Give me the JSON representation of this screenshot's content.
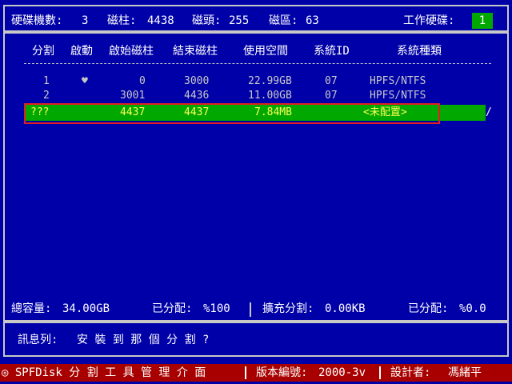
{
  "header": {
    "disk_count_label": "硬碟機數:",
    "disk_count": "3",
    "cylinders_label": "磁柱:",
    "cylinders": "4438",
    "heads_label": "磁頭:",
    "heads": "255",
    "sectors_label": "磁區:",
    "sectors": "63",
    "work_disk_label": "工作硬碟:",
    "work_disk": "1"
  },
  "columns": {
    "partition": "分割",
    "boot": "啟動",
    "start_cyl": "啟始磁柱",
    "end_cyl": "結束磁柱",
    "used_space": "使用空間",
    "system_id": "系統ID",
    "system_type": "系統種類"
  },
  "rows": [
    {
      "partition": "1",
      "boot": "♥",
      "start": "0",
      "end": "3000",
      "size": "22.99GB",
      "id": "07",
      "type": "HPFS/NTFS"
    },
    {
      "partition": "2",
      "boot": "",
      "start": "3001",
      "end": "4436",
      "size": "11.00GB",
      "id": "07",
      "type": "HPFS/NTFS"
    },
    {
      "partition": "???",
      "boot": "",
      "start": "4437",
      "end": "4437",
      "size": "7.84MB",
      "id": "",
      "type": "<未配置>"
    }
  ],
  "summary": {
    "total_label": "總容量:",
    "total": "34.00GB",
    "allocated_label": "已分配:",
    "allocated_pct": "%100",
    "extended_label": "擴充分割:",
    "extended": "0.00KB",
    "ext_allocated_label": "已分配:",
    "ext_allocated_pct": "%0.0"
  },
  "message": {
    "label": "訊息列:",
    "text": "安 裝 到 那 個 分 割 ?"
  },
  "footer": {
    "app_name": "◎ SPFDisk 分 割 工 具 管 理 介 面",
    "version_label": "版本編號:",
    "version": "2000-3v",
    "designer_label": "設計者:",
    "designer": "馮緒平"
  },
  "colors": {
    "background": "#0000a8",
    "selection": "#00a800",
    "footer": "#a80000",
    "highlight_text": "#ffff55",
    "annotation_box": "#e02020"
  }
}
